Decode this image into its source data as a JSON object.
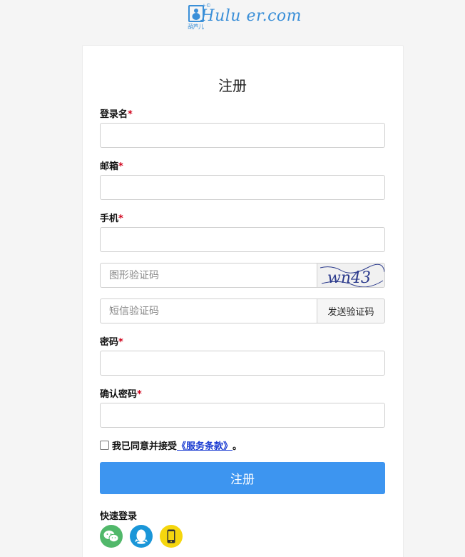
{
  "logo": {
    "text": "Hulu er.com",
    "subtitle": "葫芦儿",
    "superscript": "+©"
  },
  "form": {
    "title": "注册",
    "fields": {
      "username": {
        "label": "登录名",
        "required_mark": "*",
        "value": ""
      },
      "email": {
        "label": "邮箱",
        "required_mark": "*",
        "value": ""
      },
      "phone": {
        "label": "手机",
        "required_mark": "*",
        "value": ""
      },
      "image_captcha": {
        "placeholder": "图形验证码",
        "captcha_text": "wn43"
      },
      "sms_code": {
        "placeholder": "短信验证码",
        "button_label": "发送验证码"
      },
      "password": {
        "label": "密码",
        "required_mark": "*",
        "value": ""
      },
      "confirm_password": {
        "label": "确认密码",
        "required_mark": "*",
        "value": ""
      }
    },
    "agreement": {
      "text": "我已同意并接受",
      "link": "《服务条款》",
      "suffix": "。",
      "checked": false
    },
    "submit_label": "注册",
    "quick_login": {
      "label": "快速登录",
      "options": [
        {
          "name": "wechat-icon",
          "color": "#51b86a"
        },
        {
          "name": "qq-icon",
          "color": "#1a96d8"
        },
        {
          "name": "phone-icon",
          "color": "#f5d60e"
        }
      ]
    }
  },
  "colors": {
    "accent": "#3d95f0",
    "required": "#d0021b",
    "link": "#1a3bd1",
    "logo": "#3a8fd8"
  }
}
